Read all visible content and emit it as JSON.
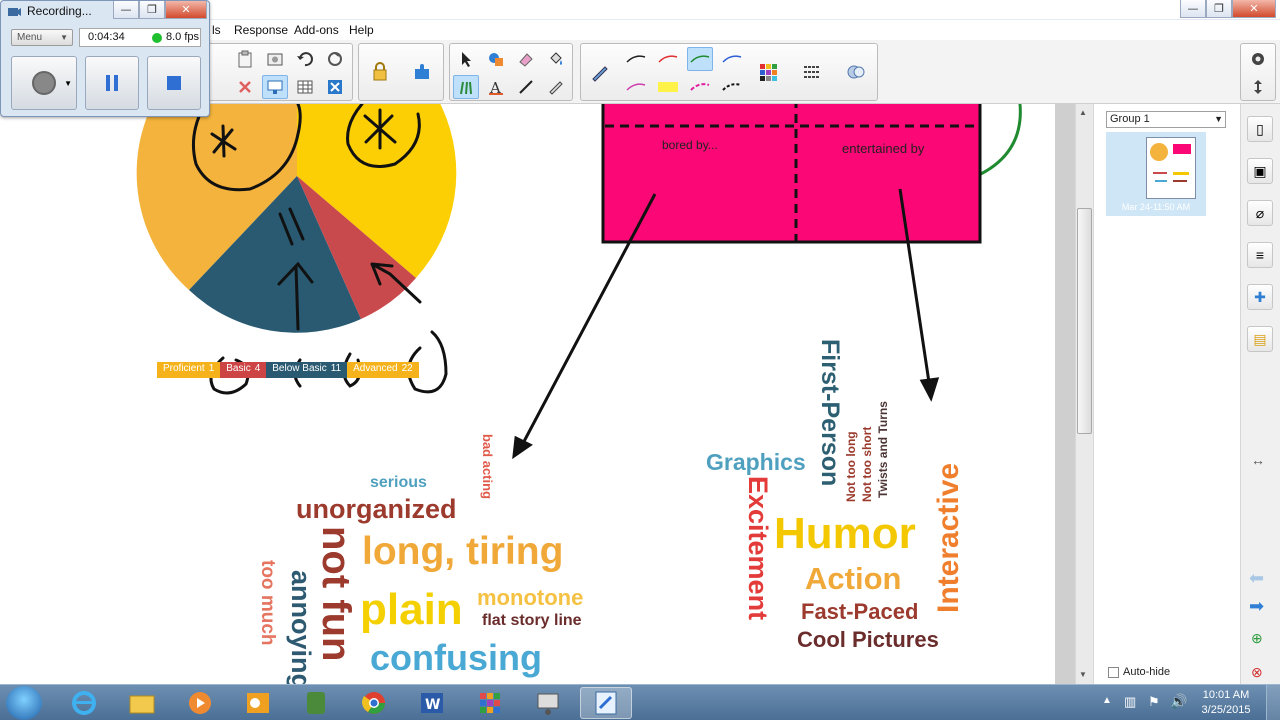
{
  "recorder": {
    "title": "Recording...",
    "menu_label": "Menu",
    "elapsed": "0:04:34",
    "fps": "8.0 fps"
  },
  "window_controls": {
    "minimize": "—",
    "restore": "❐",
    "close": "✕"
  },
  "menubar": {
    "items": [
      "ls",
      "Response",
      "Add-ons",
      "Help"
    ]
  },
  "toolbar": {
    "selected_pen_index": 2
  },
  "canvas": {
    "legend": [
      {
        "label": "Proficient",
        "value": "1",
        "color": "#f5b21b"
      },
      {
        "label": "Basic",
        "value": "4",
        "color": "#cd4445"
      },
      {
        "label": "Below Basic",
        "value": "11",
        "color": "#295a72"
      },
      {
        "label": "Advanced",
        "value": "22",
        "color": "#f5b21b"
      }
    ],
    "pie_colors": {
      "yellow": "#f3b33c",
      "gold": "#fccf05",
      "teal": "#295a72",
      "red": "#c94a4d"
    },
    "box": {
      "color": "#fc0876",
      "left_label": "bored by...",
      "right_label": "entertained by"
    },
    "bored_words": [
      {
        "text": "serious",
        "color": "#4fa0bf"
      },
      {
        "text": "bad acting",
        "color": "#e05a4a"
      },
      {
        "text": "unorganized",
        "color": "#9b3a2d"
      },
      {
        "text": "long, tiring",
        "color": "#f0a938"
      },
      {
        "text": "not fun",
        "color": "#9b3a2d"
      },
      {
        "text": "plain",
        "color": "#f4d000"
      },
      {
        "text": "monotone",
        "color": "#f5c142"
      },
      {
        "text": "flat story line",
        "color": "#6b2c2c"
      },
      {
        "text": "annoying",
        "color": "#2d5a70"
      },
      {
        "text": "too much",
        "color": "#e57460"
      },
      {
        "text": "confusing",
        "color": "#4aa9d4"
      }
    ],
    "entertained_words": [
      {
        "text": "First-Person",
        "color": "#2d5f72"
      },
      {
        "text": "Not too short",
        "color": "#9b3a2d"
      },
      {
        "text": "Not too long",
        "color": "#9b3a2d"
      },
      {
        "text": "Twists and Turns",
        "color": "#4c3434"
      },
      {
        "text": "Graphics",
        "color": "#4fa0bf"
      },
      {
        "text": "Excitement",
        "color": "#e23b39"
      },
      {
        "text": "Interactive",
        "color": "#f07f2d"
      },
      {
        "text": "Humor",
        "color": "#f4c800"
      },
      {
        "text": "Action",
        "color": "#f0a938"
      },
      {
        "text": "Fast-Paced",
        "color": "#9b3a2d"
      },
      {
        "text": "Cool Pictures",
        "color": "#6b2c2c"
      }
    ]
  },
  "side_panel": {
    "group_label": "Group 1",
    "page_date": "Mar 24-11:50 AM",
    "autohide_label": "Auto-hide"
  },
  "taskbar": {
    "time": "10:01 AM",
    "date": "3/25/2015",
    "active_index": 9
  }
}
